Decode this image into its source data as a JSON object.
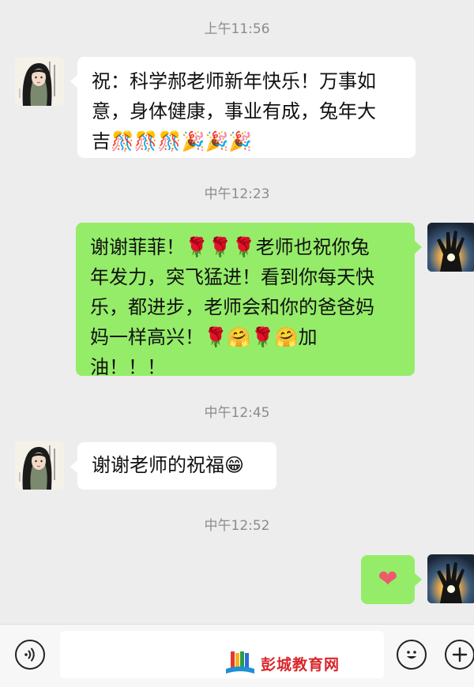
{
  "messages": [
    {
      "type": "time",
      "text": "上午11:56"
    },
    {
      "type": "in",
      "text_lines": [
        "祝：科学郝老师新年快乐！万事如",
        "意，身体健康，事业有成，兔年大",
        "吉🎊🎊🎊🎉🎉🎉"
      ]
    },
    {
      "type": "time",
      "text": "中午12:23"
    },
    {
      "type": "out",
      "text_lines": [
        "谢谢菲菲！🌹🌹🌹老师也祝你兔",
        "年发力，突飞猛进！看到你每天快",
        "乐，都进步，老师会和你的爸爸妈",
        "妈一样高兴！🌹🤗🌹🤗加",
        "油！！！"
      ]
    },
    {
      "type": "time",
      "text": "中午12:45"
    },
    {
      "type": "in",
      "text_lines": [
        "谢谢老师的祝福😁"
      ]
    },
    {
      "type": "time",
      "text": "中午12:52"
    },
    {
      "type": "out",
      "text_lines": [
        "❤"
      ]
    }
  ],
  "times": [
    "上午11:56",
    "中午12:23",
    "中午12:45",
    "中午12:52"
  ],
  "msg1": {
    "l1": "祝：科学郝老师新年快乐！万事如",
    "l2": "意，身体健康，事业有成，兔年大",
    "l3": "吉🎊🎊🎊🎉🎉🎉"
  },
  "msg2": {
    "l1": "谢谢菲菲！🌹🌹🌹老师也祝你兔",
    "l2": "年发力，突飞猛进！看到你每天快",
    "l3": "乐，都进步，老师会和你的爸爸妈",
    "l4": "妈一样高兴！🌹🤗🌹🤗加",
    "l5": "油！！！"
  },
  "msg3": {
    "l1": "谢谢老师的祝福😁"
  },
  "msg4": {
    "heart": "❤"
  },
  "input_bar": {
    "watermark_text": "彭城教育网",
    "icons": [
      "voice-icon",
      "emoji-icon",
      "plus-icon"
    ]
  },
  "colors": {
    "background": "#ededed",
    "incoming_bubble": "#ffffff",
    "outgoing_bubble": "#95ec69",
    "watermark": "#d8262b"
  }
}
